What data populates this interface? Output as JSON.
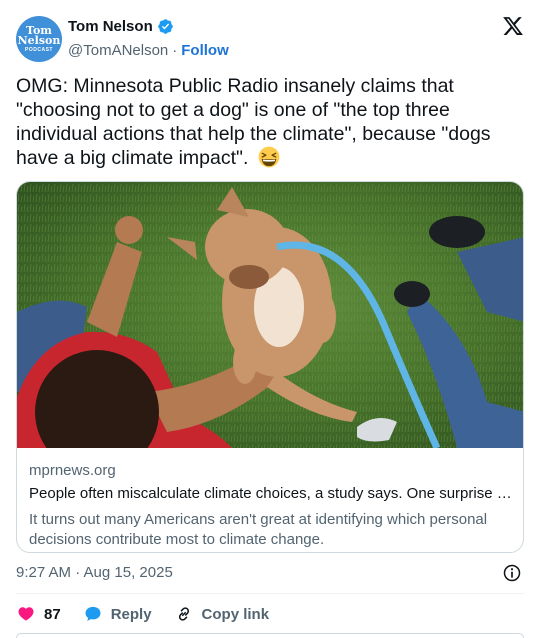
{
  "author": {
    "avatar_lines": [
      "Tom",
      "Nelson",
      "PODCAST"
    ],
    "name": "Tom Nelson",
    "handle": "@TomANelson",
    "separator": "·",
    "follow_label": "Follow",
    "verified_icon": "verified-badge-icon",
    "brand_icon": "x-logo-icon"
  },
  "tweet": {
    "text": "OMG: Minnesota Public Radio insanely claims that \"choosing not to get a dog\" is one of \"the top three individual actions that help the climate\", because \"dogs have a big climate impact\".",
    "emoji": "grinning-squinting-face-emoji"
  },
  "link_card": {
    "image": "child-petting-dog-on-grass-photo",
    "domain": "mprnews.org",
    "headline": "People often miscalculate climate choices, a study says. One surprise is o…",
    "description": "It turns out many Americans aren't great at identifying which personal decisions contribute most to climate change."
  },
  "footer": {
    "timestamp": "9:27 AM · Aug 15, 2025",
    "info_icon": "info-icon"
  },
  "actions": {
    "like_count": "87",
    "reply_label": "Reply",
    "copy_link_label": "Copy link"
  },
  "colors": {
    "accent": "#1d9bf0",
    "like": "#f91880",
    "text": "#0f1419",
    "muted": "#536471",
    "border": "#cfd9de"
  }
}
